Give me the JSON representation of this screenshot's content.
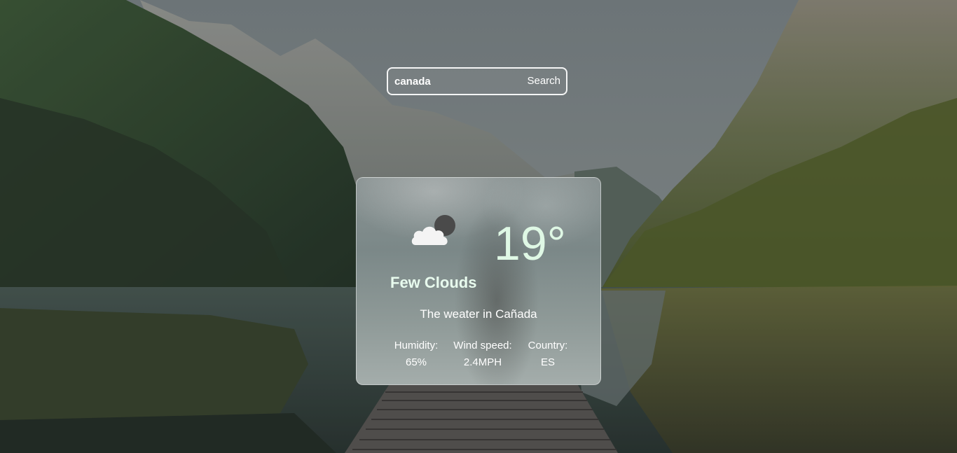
{
  "search": {
    "value": "canada",
    "button_label": "Search"
  },
  "weather": {
    "icon": "few-clouds-icon",
    "temperature": "19°",
    "condition": "Few Clouds",
    "location_text": "The weater in Cañada",
    "stats": {
      "humidity_label": "Humidity:",
      "humidity_value": "65%",
      "wind_label": "Wind speed:",
      "wind_value": "2.4MPH",
      "country_label": "Country:",
      "country_value": "ES"
    }
  },
  "colors": {
    "temperature": "#dff8e5",
    "condition": "#e8fbee",
    "card_border": "#ffffff"
  }
}
